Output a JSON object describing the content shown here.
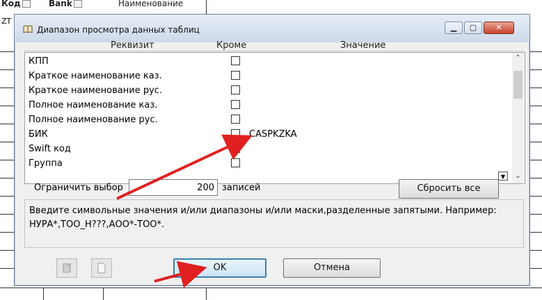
{
  "background": {
    "headers": [
      "Код",
      "Bank",
      "Наименование"
    ],
    "side_label": "ZT"
  },
  "dialog": {
    "title": "Диапазон просмотра данных таблиц",
    "columns": {
      "attribute": "Реквизит",
      "except": "Кроме",
      "value": "Значение"
    },
    "rows": [
      {
        "label": "КПП",
        "checked": false,
        "value": ""
      },
      {
        "label": "Краткое наименование каз.",
        "checked": false,
        "value": ""
      },
      {
        "label": "Краткое наименование рус.",
        "checked": false,
        "value": ""
      },
      {
        "label": "Полное наименование каз.",
        "checked": false,
        "value": ""
      },
      {
        "label": "Полное наименование рус.",
        "checked": false,
        "value": ""
      },
      {
        "label": "БИК",
        "checked": false,
        "value": "CASPKZKA"
      },
      {
        "label": "Swift код",
        "checked": false,
        "value": ""
      },
      {
        "label": "Группа",
        "checked": false,
        "value": ""
      }
    ],
    "limit": {
      "label": "Ограничить выбор",
      "value": "200",
      "suffix": "записей"
    },
    "reset_label": "Сбросить все",
    "hint": "Введите символьные значения и/или диапазоны и/или маски,разделенные запятыми. Например: НУРА*,ТОО_Н???,АОО*-ТОО*.",
    "ok_label": "OK",
    "cancel_label": "Отмена"
  },
  "colors": {
    "annotation_arrow": "#e02020",
    "ok_border": "#3c7fb1",
    "title_gradient_top": "#e6eef8"
  }
}
